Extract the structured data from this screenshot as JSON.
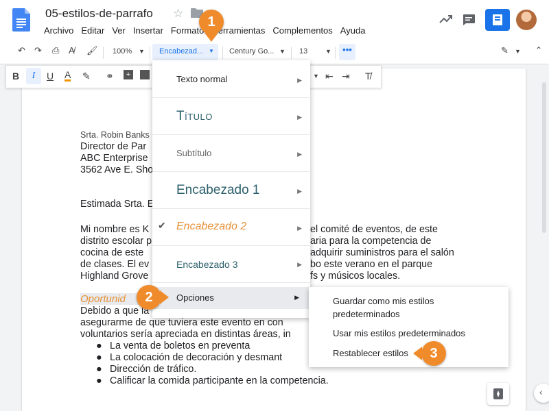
{
  "app": {
    "title": "05-estilos-de-parrafo"
  },
  "menu": [
    "Archivo",
    "Editar",
    "Ver",
    "Insertar",
    "Formato",
    "Herramientas",
    "Complementos",
    "Ayuda"
  ],
  "toolbar": {
    "zoom": "100%",
    "style": "Encabezad...",
    "font": "Century Go...",
    "size": "13",
    "more": "•••"
  },
  "document": {
    "address": [
      "Srta. Robin Banks",
      "Director de Par",
      "ABC Enterprise",
      "3562 Ave E. Sho"
    ],
    "greeting": "Estimada Srta. E",
    "para1": [
      {
        "left": "Mi nombre es K",
        "right": "el comité de eventos, de este"
      },
      {
        "left": "distrito escolar p",
        "right": "aria para la competencia de"
      },
      {
        "left": "cocina de este",
        "right": "adquirir suministros para el salón"
      },
      {
        "left": "de clases. El ev",
        "right": "bo este verano en el parque"
      },
      {
        "left": "Highland Grove",
        "right": "fs y músicos locales."
      }
    ],
    "heading": "Oportunid",
    "para2": [
      "Debido a que la organización ha participado e",
      "asegurarme de que tuviera este evento en con",
      "voluntarios sería apreciada en distintas áreas, in"
    ],
    "bullets": [
      "La venta de boletos en preventa",
      "La colocación de decoración y desmant",
      "Dirección de tráfico.",
      "Calificar la comida participante en la competencia."
    ]
  },
  "style_menu": {
    "items": [
      {
        "label": "Texto normal"
      },
      {
        "label": "Título"
      },
      {
        "label": "Subtítulo"
      },
      {
        "label": "Encabezado 1"
      },
      {
        "label": "Encabezado 2"
      },
      {
        "label": "Encabezado 3"
      },
      {
        "label": "Opciones"
      }
    ]
  },
  "submenu": {
    "items": [
      "Guardar como mis estilos predeterminados",
      "Usar mis estilos predeterminados",
      "Restablecer estilos"
    ]
  },
  "callouts": [
    "1",
    "2",
    "3"
  ],
  "colors": {
    "accent": "#1a73e8",
    "callout": "#f08b2c",
    "heading2": "#e69138",
    "title": "#2b5f6b"
  }
}
